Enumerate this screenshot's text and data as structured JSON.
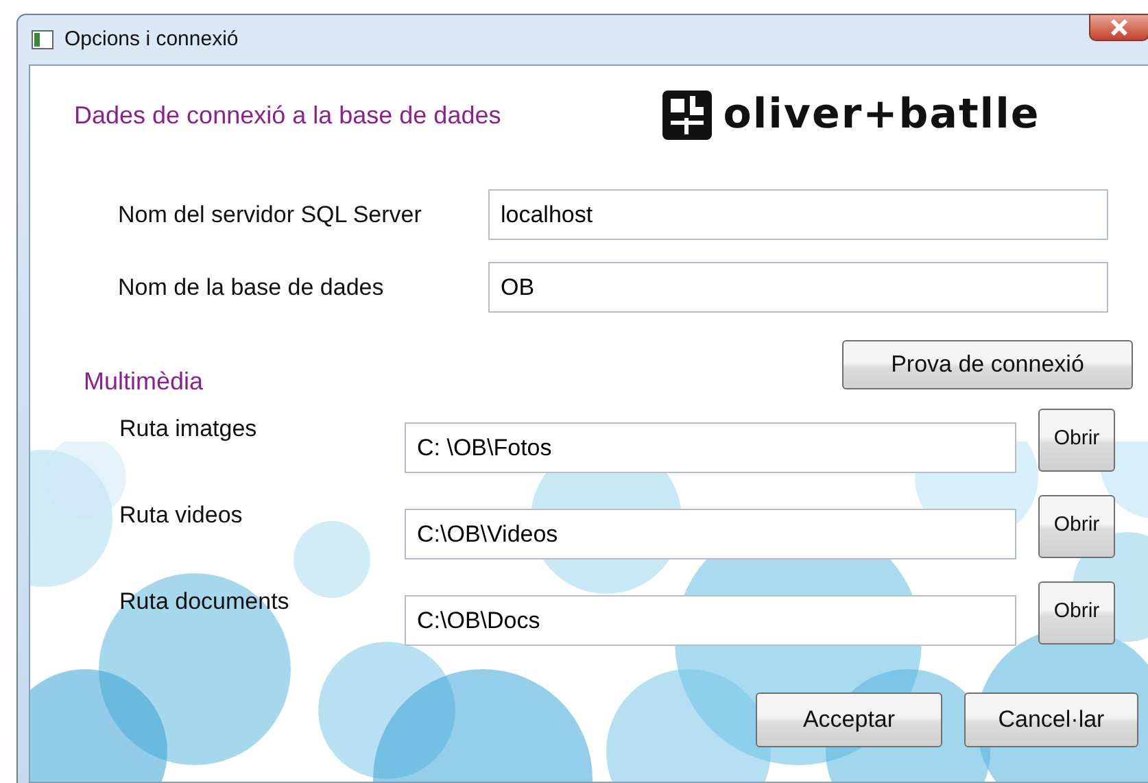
{
  "window": {
    "title": "Opcions i connexió"
  },
  "connection": {
    "heading": "Dades de connexió a la base de dades",
    "logo_text": "oliver+batlle",
    "fields": [
      {
        "label": "Nom del servidor SQL Server",
        "value": "localhost"
      },
      {
        "label": "Nom de la base de dades",
        "value": "OB"
      }
    ],
    "test_button": "Prova de connexió"
  },
  "background": {
    "kind": "picture"
  },
  "multimedia": {
    "heading": "Multimèdia",
    "paths": [
      {
        "label": "Ruta imatges",
        "value": "C: \\OB\\Fotos",
        "button": "Obrir"
      },
      {
        "label": "Ruta videos",
        "value": "C:\\OB\\Videos",
        "button": "Obrir"
      },
      {
        "label": "Ruta documents",
        "value": "C:\\OB\\Docs",
        "button": "Obrir"
      }
    ]
  },
  "buttons": [
    "Acceptar",
    "Cancel·lar"
  ]
}
